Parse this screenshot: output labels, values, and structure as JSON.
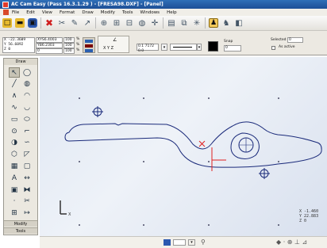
{
  "window": {
    "title": "AC Cam Easy (Pass 16.3.1.29 ) - [FRESA98.DXF] - [Panel]"
  },
  "menu": [
    "File",
    "Edit",
    "View",
    "Format",
    "Draw",
    "Modify",
    "Tools",
    "Windows",
    "Help"
  ],
  "toolbar": {
    "items": [
      {
        "name": "new-file-icon",
        "glyph": "□",
        "style": "yellow"
      },
      {
        "name": "open-folder-icon",
        "glyph": "▬",
        "style": "yellow"
      },
      {
        "name": "save-disk-icon",
        "glyph": "▣",
        "style": "blue"
      },
      {
        "name": "delete-x-icon",
        "glyph": "✖",
        "style": "red"
      },
      {
        "name": "cut-icon",
        "glyph": "✂",
        "style": "gray"
      },
      {
        "name": "paint-icon",
        "glyph": "✎",
        "style": "gray"
      },
      {
        "name": "arrow-icon",
        "glyph": "↗",
        "style": "gray"
      },
      {
        "name": "zoom-in-icon",
        "glyph": "⊕",
        "style": "gray"
      },
      {
        "name": "zoom-window-icon",
        "glyph": "⊞",
        "style": "gray"
      },
      {
        "name": "table-icon",
        "glyph": "⊟",
        "style": "gray"
      },
      {
        "name": "globe-icon",
        "glyph": "◍",
        "style": "gray"
      },
      {
        "name": "pan-icon",
        "glyph": "✛",
        "style": "gray"
      },
      {
        "name": "layers-icon",
        "glyph": "▤",
        "style": "gray"
      },
      {
        "name": "copy-icon",
        "glyph": "⧉",
        "style": "gray"
      },
      {
        "name": "star-icon",
        "glyph": "✳",
        "style": "gray"
      },
      {
        "name": "person-icon",
        "glyph": "♟",
        "style": "pressed"
      },
      {
        "name": "person-alt-icon",
        "glyph": "♞",
        "style": "gray"
      },
      {
        "name": "layer-color-icon",
        "glyph": "◧",
        "style": "gray"
      }
    ]
  },
  "properties": {
    "x_readout": "X -22.3609",
    "y_readout": "Y 56.6092",
    "z_readout": "Z 0",
    "field_top_1": "XYS6.4003",
    "field_top_2": "100",
    "unit_1": "%",
    "field_mid_1": "YB6.2303",
    "field_mid_2": "100",
    "unit_2": "%",
    "field_bot_1": "0",
    "field_bot_2": "100",
    "unit_3": "%",
    "angle_label": "∠",
    "xyz_label": "X Y Z",
    "linetype_value": "0.1 7172 0.0",
    "snap_label": "Snap",
    "selected_label": "Selected",
    "selected_value": "0",
    "as_active_label": "As active",
    "snap_value": "0"
  },
  "palette": {
    "title": "Draw",
    "modify_label": "Modify",
    "tools_label": "Tools",
    "icons": [
      "pointer-icon",
      "circle-icon",
      "line-icon",
      "circle-3p-icon",
      "polyline-icon",
      "arc-icon",
      "spline-icon",
      "arc-3p-icon",
      "rect-icon",
      "ellipse-icon",
      "circle-center-icon",
      "fillet-icon",
      "ellipse-arc-icon",
      "curve-icon",
      "polygon-icon",
      "chamfer-icon",
      "hatch-icon",
      "offset-icon",
      "text-icon",
      "dimension-icon",
      "block-icon",
      "mirror-icon",
      "point-icon",
      "trim-icon",
      "insert-icon",
      "extend-icon"
    ]
  },
  "canvas": {
    "readout": {
      "x": "X -1.460",
      "y": "Y 22.883",
      "z": "Z 0"
    },
    "axis_x_label": "X"
  },
  "status": {
    "icons": [
      "layer-status-icon",
      "box-status-icon",
      "pin-icon",
      "snap-status-icon"
    ]
  },
  "colors": {
    "accent": "#2b58b0",
    "drawing_line": "#1a2a7a",
    "marker_red": "#e02020"
  }
}
